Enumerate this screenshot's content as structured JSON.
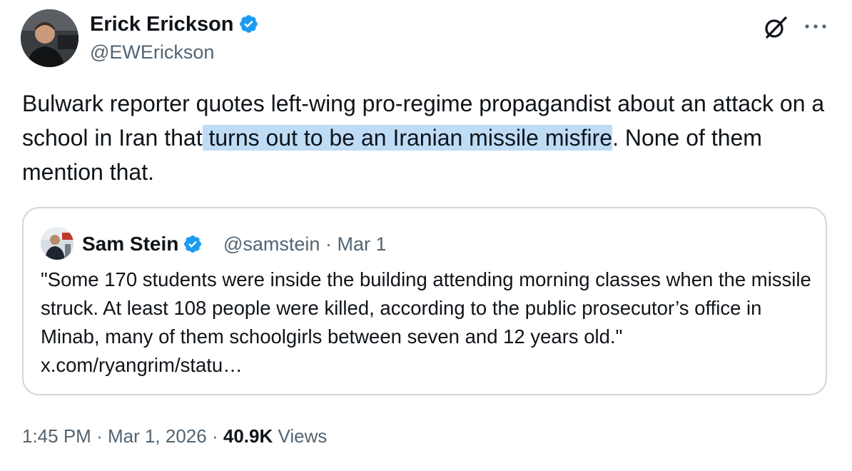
{
  "author": {
    "name": "Erick Erickson",
    "handle": "@EWErickson"
  },
  "icons": {
    "verified": "verified-badge-icon",
    "grok": "grok-icon",
    "more": "more-options-icon",
    "brand_color": "#1d9bf0"
  },
  "tweet": {
    "text_before": "Bulwark reporter quotes left-wing pro-regime propagandist about an attack on a school in Iran that",
    "text_highlight": " turns out to be an Iranian missile misfire",
    "text_after": ". None of them mention that.",
    "highlight_color": "#bfdcf7"
  },
  "quote": {
    "name": "Sam Stein",
    "handle": "@samstein",
    "separator": "·",
    "date": "Mar 1",
    "text_body": "\"Some 170 students were inside the building attending morning classes when the missile struck. At least 108 people were killed, according to the public prosecutor’s office in Minab, many of them schoolgirls between seven and 12 years old.\"",
    "link": "x.com/ryangrim/statu…"
  },
  "footer": {
    "time": "1:45 PM",
    "sep1": "·",
    "date": "Mar 1, 2026",
    "sep2": "·",
    "views_count": "40.9K",
    "views_label": "Views"
  }
}
